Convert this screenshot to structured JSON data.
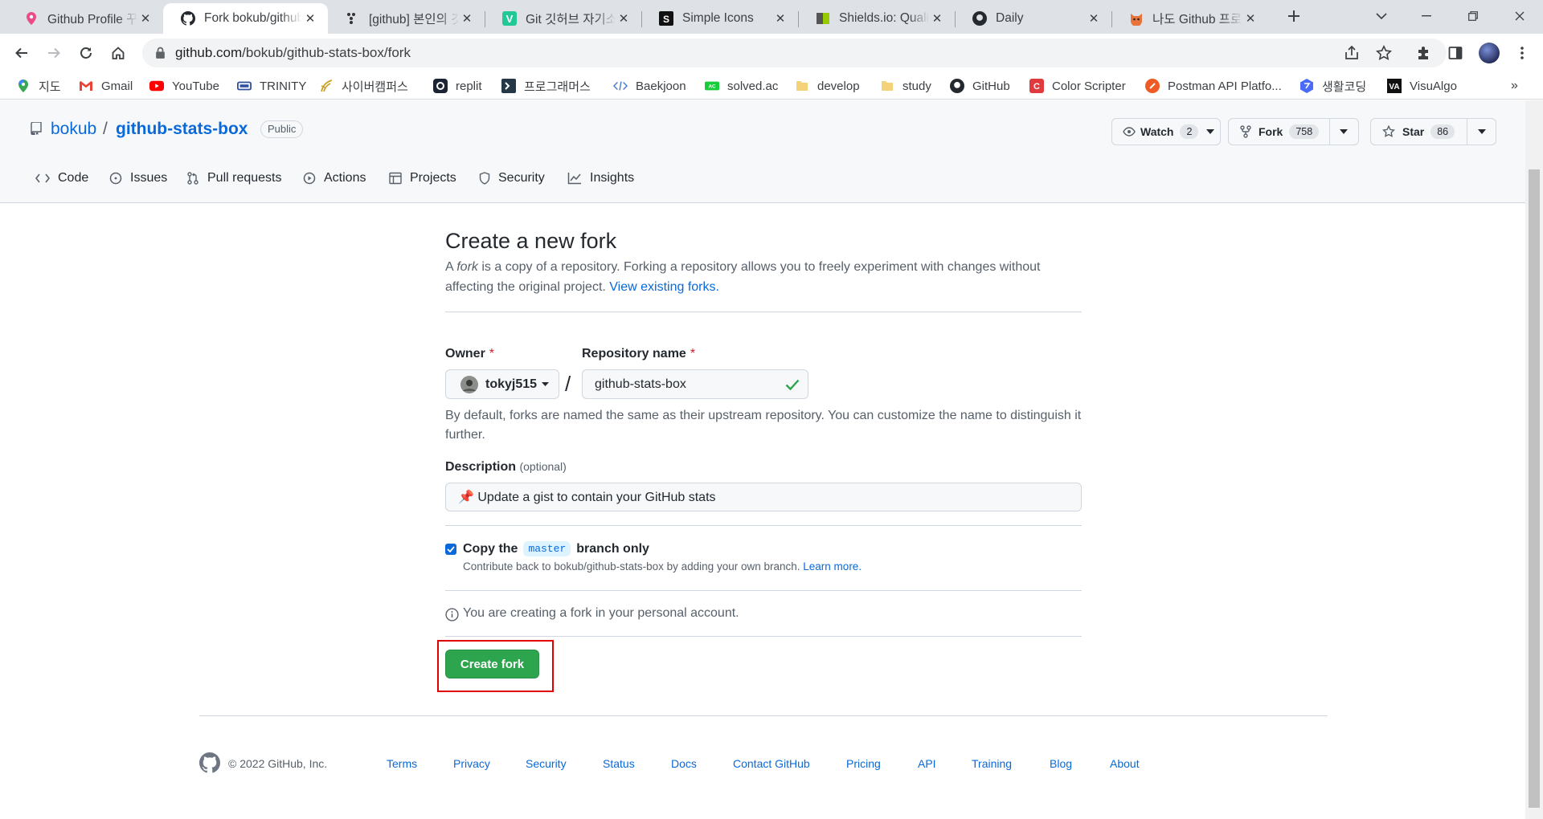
{
  "browser": {
    "tabs": [
      {
        "title": "Github Profile 꾸미기",
        "favicon": "pin-icon"
      },
      {
        "title": "Fork bokub/github-stats-box",
        "favicon": "github-icon",
        "active": true
      },
      {
        "title": "[github] 본인의 깃허브",
        "favicon": "dots-icon"
      },
      {
        "title": "Git 깃허브 자기소개",
        "favicon": "velog-icon"
      },
      {
        "title": "Simple Icons",
        "favicon": "simpleicons-icon"
      },
      {
        "title": "Shields.io: Quality",
        "favicon": "shields-icon"
      },
      {
        "title": "Daily",
        "favicon": "github-icon"
      },
      {
        "title": "나도 Github 프로필",
        "favicon": "fox-icon"
      }
    ],
    "url_host": "github.com",
    "url_path": "/bokub/github-stats-box/fork",
    "bookmarks": [
      "지도",
      "Gmail",
      "YouTube",
      "TRINITY",
      "사이버캠퍼스",
      "replit",
      "프로그래머스",
      "Baekjoon",
      "solved.ac",
      "develop",
      "study",
      "GitHub",
      "Color Scripter",
      "Postman API Platfo...",
      "생활코딩",
      "VisuAlgo"
    ]
  },
  "repo": {
    "owner": "bokub",
    "name": "github-stats-box",
    "visibility": "Public",
    "watch_label": "Watch",
    "watch_count": "2",
    "fork_label": "Fork",
    "fork_count": "758",
    "star_label": "Star",
    "star_count": "86",
    "tabs": [
      "Code",
      "Issues",
      "Pull requests",
      "Actions",
      "Projects",
      "Security",
      "Insights"
    ]
  },
  "fork_form": {
    "title": "Create a new fork",
    "intro_a": "A ",
    "intro_em": "fork",
    "intro_b": " is a copy of a repository. Forking a repository allows you to freely experiment with changes without affecting the original project. ",
    "intro_link": "View existing forks.",
    "owner_label": "Owner",
    "required_mark": "*",
    "owner_value": "tokyj515",
    "slash": "/",
    "repo_label": "Repository name",
    "repo_value": "github-stats-box",
    "name_hint": "By default, forks are named the same as their upstream repository. You can customize the name to distinguish it further.",
    "description_label": "Description",
    "optional": "(optional)",
    "description_value": "📌 Update a gist to contain your GitHub stats",
    "copy_a": "Copy the",
    "copy_branch": "master",
    "copy_b": "branch only",
    "copy_checked": true,
    "copy_hint": "Contribute back to bokub/github-stats-box by adding your own branch.",
    "copy_hint_link": "Learn more.",
    "account_note": "You are creating a fork in your personal account.",
    "submit_label": "Create fork",
    "accent": "#2da44e",
    "highlight": "#e00000"
  },
  "footer": {
    "copyright": "© 2022 GitHub, Inc.",
    "links": [
      "Terms",
      "Privacy",
      "Security",
      "Status",
      "Docs",
      "Contact GitHub",
      "Pricing",
      "API",
      "Training",
      "Blog",
      "About"
    ]
  }
}
